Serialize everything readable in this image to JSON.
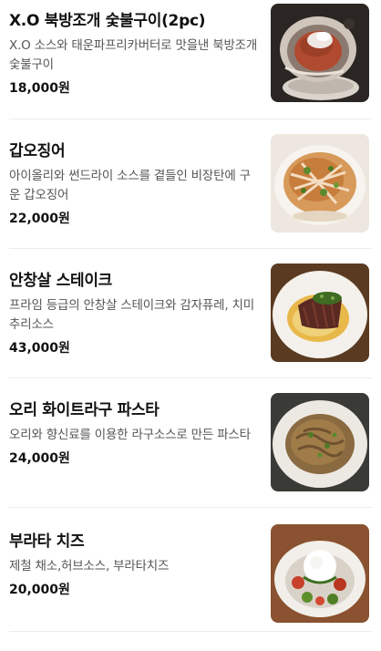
{
  "menu": {
    "items": [
      {
        "name": "X.O 북방조개 숯불구이(2pc)",
        "description": "X.O 소스와 태운파프리카버터로 맛을낸 북방조개 숯불구이",
        "price": "18,000원",
        "image": "grilled-surf-clam-photo"
      },
      {
        "name": "갑오징어",
        "description": "아이올리와 썬드라이 소스를 곁들인 비장탄에 구운 갑오징어",
        "price": "22,000원",
        "image": "grilled-cuttlefish-photo"
      },
      {
        "name": "안창살 스테이크",
        "description": "프라임 등급의 안창살 스테이크와 감자퓨레, 치미추리소스",
        "price": "43,000원",
        "image": "skirt-steak-photo"
      },
      {
        "name": "오리 화이트라구 파스타",
        "description": "오리와 향신료를 이용한 라구소스로 만든 파스타",
        "price": "24,000원",
        "image": "duck-ragu-pasta-photo"
      },
      {
        "name": "부라타 치즈",
        "description": "제철 채소,허브소스, 부라타치즈",
        "price": "20,000원",
        "image": "burrata-cheese-photo"
      }
    ]
  }
}
